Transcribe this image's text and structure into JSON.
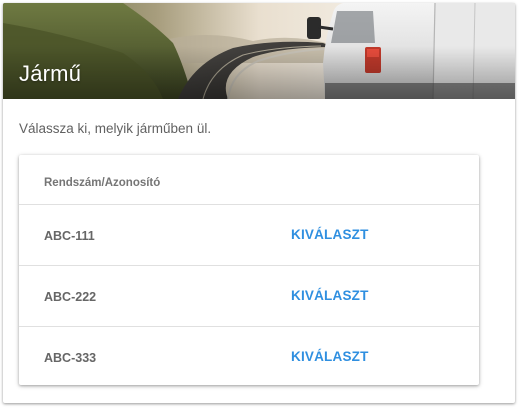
{
  "header": {
    "title": "Jármű"
  },
  "instruction": "Válassza ki, melyik járműben ül.",
  "table": {
    "column_header": "Rendszám/Azonosító",
    "rows": [
      {
        "id": "ABC-111",
        "action_label": "KIVÁLASZT"
      },
      {
        "id": "ABC-222",
        "action_label": "KIVÁLASZT"
      },
      {
        "id": "ABC-333",
        "action_label": "KIVÁLASZT"
      }
    ]
  },
  "colors": {
    "accent": "#2f8fe0",
    "header_text": "#757575",
    "body_text": "#616161"
  }
}
